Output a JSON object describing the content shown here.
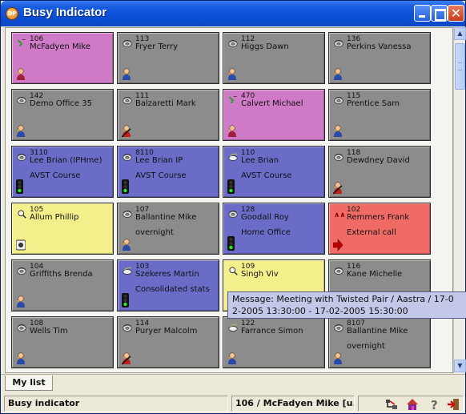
{
  "window": {
    "title": "Busy Indicator"
  },
  "colors": {
    "grey": "#8c8c8c",
    "pink": "#cf7ac6",
    "blue": "#6a6cc8",
    "yellow": "#f3ef8a",
    "red": "#f06a66"
  },
  "tiles": [
    {
      "ext": "106",
      "name": "McFadyen Mike",
      "note": "",
      "color": "pink",
      "icon": "phone-ringing-icon",
      "status_icon": "person-busy-icon"
    },
    {
      "ext": "113",
      "name": "Fryer Terry",
      "note": "",
      "color": "grey",
      "icon": "phone-icon",
      "status_icon": "person-icon"
    },
    {
      "ext": "112",
      "name": "Higgs Dawn",
      "note": "",
      "color": "grey",
      "icon": "phone-icon",
      "status_icon": "person-icon"
    },
    {
      "ext": "136",
      "name": "Perkins Vanessa",
      "note": "",
      "color": "grey",
      "icon": "phone-icon",
      "status_icon": "person-icon"
    },
    {
      "ext": "142",
      "name": "Demo Office 35",
      "note": "",
      "color": "grey",
      "icon": "phone-icon",
      "status_icon": "person-icon"
    },
    {
      "ext": "111",
      "name": "Balzaretti Mark",
      "note": "",
      "color": "grey",
      "icon": "phone-icon",
      "status_icon": "person-away-icon"
    },
    {
      "ext": "470",
      "name": "Calvert Michael",
      "note": "",
      "color": "pink",
      "icon": "phone-ringing-icon",
      "status_icon": "person-busy-icon"
    },
    {
      "ext": "115",
      "name": "Prentice Sam",
      "note": "",
      "color": "grey",
      "icon": "phone-icon",
      "status_icon": "person-icon"
    },
    {
      "ext": "3110",
      "name": "Lee Brian (IPHme)",
      "note": "AVST Course",
      "color": "blue",
      "icon": "phone-icon",
      "status_icon": "traffic-light-icon"
    },
    {
      "ext": "8110",
      "name": "Lee Brian IP",
      "note": "AVST Course",
      "color": "blue",
      "icon": "phone-icon",
      "status_icon": "traffic-light-icon"
    },
    {
      "ext": "110",
      "name": "Lee Brian",
      "note": "AVST Course",
      "color": "blue",
      "icon": "phone-offhook-icon",
      "status_icon": "traffic-light-icon"
    },
    {
      "ext": "118",
      "name": "Dewdney David",
      "note": "",
      "color": "grey",
      "icon": "phone-icon",
      "status_icon": "person-away-icon"
    },
    {
      "ext": "105",
      "name": "Allum Phillip",
      "note": "",
      "color": "yellow",
      "icon": "phone-search-icon",
      "status_icon": "calendar-icon"
    },
    {
      "ext": "107",
      "name": "Ballantine Mike",
      "note": "overnight",
      "color": "grey",
      "icon": "phone-icon",
      "status_icon": "person-icon"
    },
    {
      "ext": "128",
      "name": "Goodall Roy",
      "note": "Home Office",
      "color": "blue",
      "icon": "phone-icon",
      "status_icon": "traffic-light-icon"
    },
    {
      "ext": "102",
      "name": "Remmers Frank",
      "note": "External call",
      "color": "red",
      "icon": "people-icon",
      "status_icon": "arrow-right-icon"
    },
    {
      "ext": "104",
      "name": "Griffiths Brenda",
      "note": "",
      "color": "grey",
      "icon": "phone-icon",
      "status_icon": "person-icon"
    },
    {
      "ext": "103",
      "name": "Szekeres Martin",
      "note": "Consolidated stats",
      "color": "blue",
      "icon": "phone-offhook-icon",
      "status_icon": "traffic-light-icon"
    },
    {
      "ext": "109",
      "name": "Singh Viv",
      "note": "",
      "color": "yellow",
      "icon": "phone-search-icon",
      "status_icon": "calendar-icon"
    },
    {
      "ext": "116",
      "name": "Kane Michelle",
      "note": "",
      "color": "grey",
      "icon": "phone-icon",
      "status_icon": "person-icon"
    },
    {
      "ext": "108",
      "name": "Wells Tim",
      "note": "",
      "color": "grey",
      "icon": "phone-icon",
      "status_icon": "person-icon"
    },
    {
      "ext": "114",
      "name": "Puryer Malcolm",
      "note": "",
      "color": "grey",
      "icon": "phone-icon",
      "status_icon": "person-away-icon"
    },
    {
      "ext": "122",
      "name": "Farrance Simon",
      "note": "",
      "color": "grey",
      "icon": "phone-offhook-icon",
      "status_icon": "person-icon"
    },
    {
      "ext": "8107",
      "name": "Ballantine Mike",
      "note": "overnight",
      "color": "grey",
      "icon": "phone-icon",
      "status_icon": "person-icon"
    }
  ],
  "tooltip": {
    "line1": "Message: Meeting with Twisted Pair / Aastra / 17-0",
    "line2": "2-2005 13:30:00 - 17-02-2005 15:30:00"
  },
  "tabs": [
    {
      "label": "My list"
    }
  ],
  "status": {
    "left": "Busy indicator",
    "middle": "106 / McFadyen Mike [u...",
    "icons": [
      "network-icon",
      "home-icon",
      "help-icon",
      "exit-icon"
    ]
  }
}
